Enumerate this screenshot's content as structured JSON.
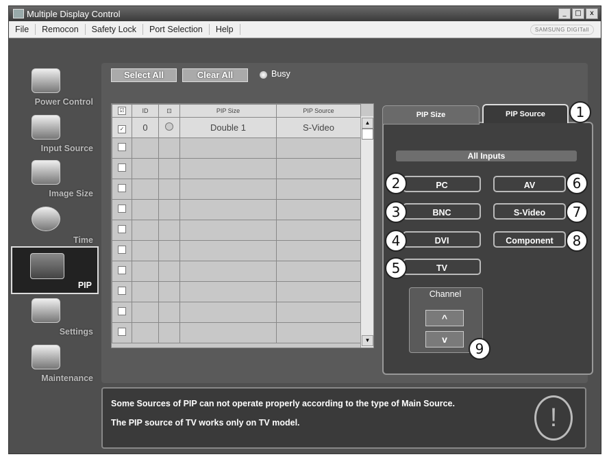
{
  "window": {
    "title": "Multiple Display Control",
    "controls": [
      "_",
      "□",
      "x"
    ]
  },
  "menu": [
    "File",
    "Remocon",
    "Safety Lock",
    "Port Selection",
    "Help"
  ],
  "brand": "SAMSUNG DIGITall",
  "sidebar": {
    "items": [
      {
        "label": "Power Control",
        "icon": "power-icon"
      },
      {
        "label": "Input Source",
        "icon": "input-source-icon"
      },
      {
        "label": "Image Size",
        "icon": "image-size-icon"
      },
      {
        "label": "Time",
        "icon": "clock-icon"
      },
      {
        "label": "PIP",
        "icon": "pip-icon",
        "active": true
      },
      {
        "label": "Settings",
        "icon": "settings-icon"
      },
      {
        "label": "Maintenance",
        "icon": "maintenance-icon"
      }
    ]
  },
  "toolbar": {
    "select_all": "Select All",
    "clear_all": "Clear All",
    "busy": "Busy"
  },
  "table": {
    "headers": [
      "☑",
      "ID",
      "⊡",
      "PIP Size",
      "PIP Source"
    ],
    "rows": [
      {
        "id": "0",
        "pip_size": "Double 1",
        "pip_source": "S-Video"
      }
    ]
  },
  "tabs": {
    "pip_size": "PIP Size",
    "pip_source": "PIP Source"
  },
  "sources": {
    "heading": "All Inputs",
    "pc": "PC",
    "bnc": "BNC",
    "dvi": "DVI",
    "tv": "TV",
    "av": "AV",
    "svideo": "S-Video",
    "component": "Component"
  },
  "channel": {
    "label": "Channel",
    "up": "^",
    "down": "v"
  },
  "callouts": [
    "1",
    "2",
    "3",
    "4",
    "5",
    "6",
    "7",
    "8",
    "9"
  ],
  "message": {
    "line1": "Some Sources of PIP can not operate properly according to the type of Main Source.",
    "line2": "The PIP source of TV works only on TV model.",
    "icon": "!"
  }
}
